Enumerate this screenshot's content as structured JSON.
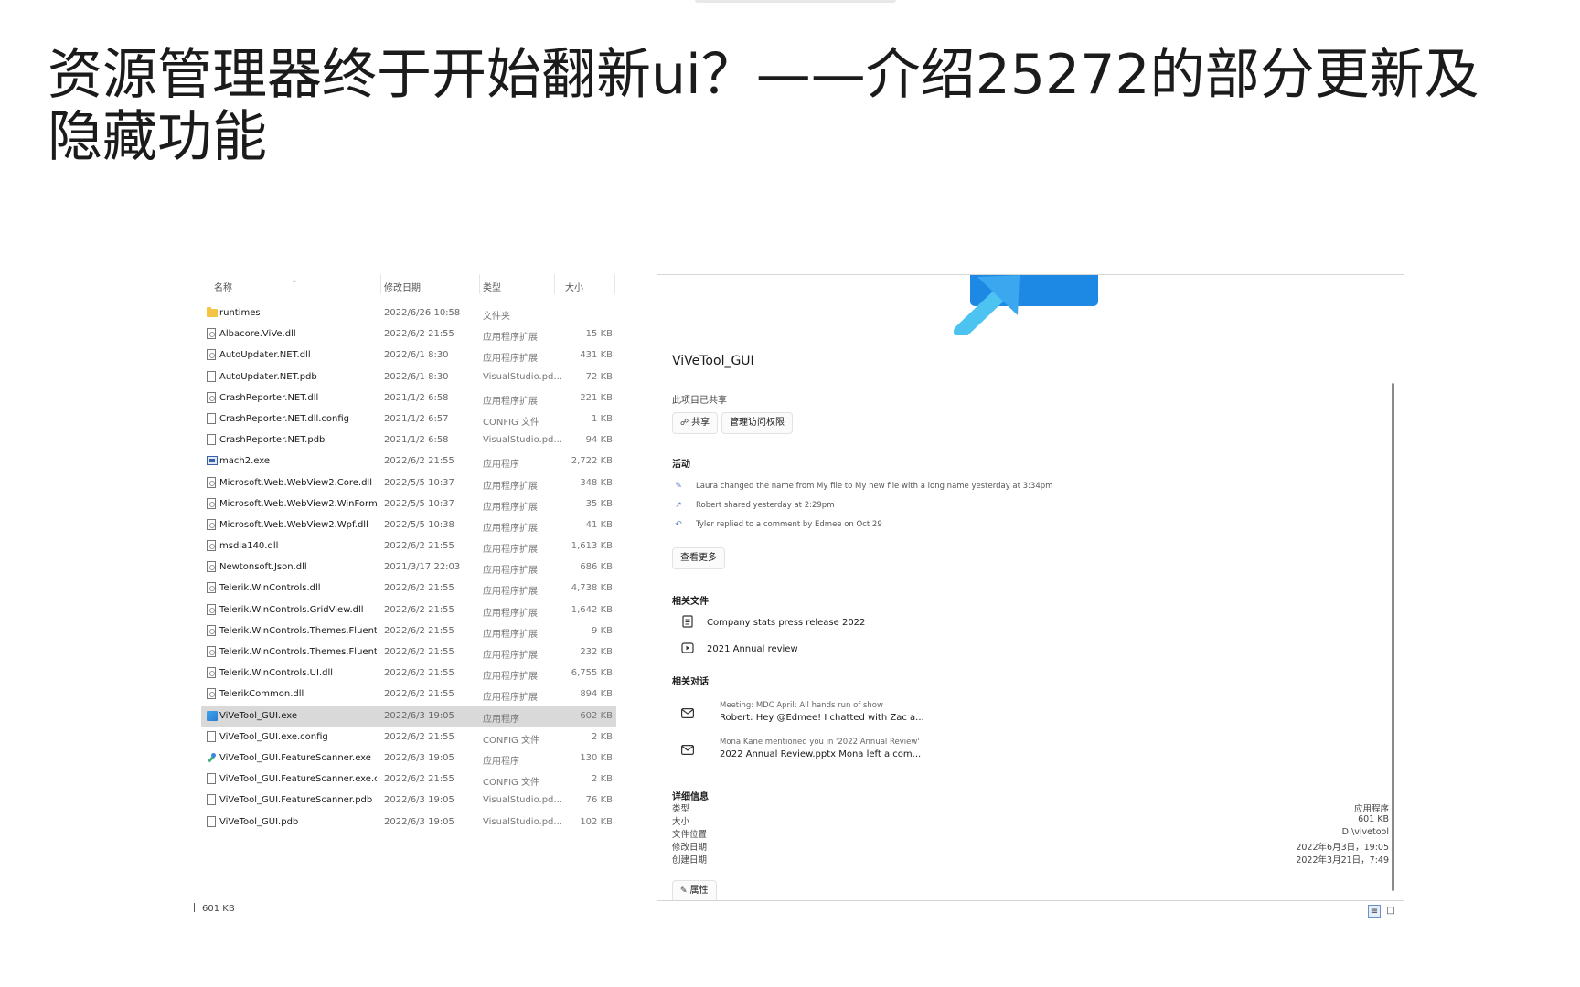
{
  "page_title": "资源管理器终于开始翻新ui？——介绍25272的部分更新及隐藏功能",
  "file_list": {
    "columns": [
      "名称",
      "修改日期",
      "类型",
      "大小"
    ],
    "rows": [
      {
        "name": "runtimes",
        "date": "2022/6/26 10:58",
        "type": "文件夹",
        "size": "",
        "icon": "folder-icon"
      },
      {
        "name": "Albacore.ViVe.dll",
        "date": "2022/6/2 21:55",
        "type": "应用程序扩展",
        "size": "15 KB",
        "icon": "dll-file-icon"
      },
      {
        "name": "AutoUpdater.NET.dll",
        "date": "2022/6/1 8:30",
        "type": "应用程序扩展",
        "size": "431 KB",
        "icon": "dll-file-icon"
      },
      {
        "name": "AutoUpdater.NET.pdb",
        "date": "2022/6/1 8:30",
        "type": "VisualStudio.pd...",
        "size": "72 KB",
        "icon": "file-icon"
      },
      {
        "name": "CrashReporter.NET.dll",
        "date": "2021/1/2 6:58",
        "type": "应用程序扩展",
        "size": "221 KB",
        "icon": "dll-file-icon"
      },
      {
        "name": "CrashReporter.NET.dll.config",
        "date": "2021/1/2 6:57",
        "type": "CONFIG 文件",
        "size": "1 KB",
        "icon": "file-icon"
      },
      {
        "name": "CrashReporter.NET.pdb",
        "date": "2021/1/2 6:58",
        "type": "VisualStudio.pd...",
        "size": "94 KB",
        "icon": "file-icon"
      },
      {
        "name": "mach2.exe",
        "date": "2022/6/2 21:55",
        "type": "应用程序",
        "size": "2,722 KB",
        "icon": "exe-icon"
      },
      {
        "name": "Microsoft.Web.WebView2.Core.dll",
        "date": "2022/5/5 10:37",
        "type": "应用程序扩展",
        "size": "348 KB",
        "icon": "dll-file-icon"
      },
      {
        "name": "Microsoft.Web.WebView2.WinForms....",
        "date": "2022/5/5 10:37",
        "type": "应用程序扩展",
        "size": "35 KB",
        "icon": "dll-file-icon"
      },
      {
        "name": "Microsoft.Web.WebView2.Wpf.dll",
        "date": "2022/5/5 10:38",
        "type": "应用程序扩展",
        "size": "41 KB",
        "icon": "dll-file-icon"
      },
      {
        "name": "msdia140.dll",
        "date": "2022/6/2 21:55",
        "type": "应用程序扩展",
        "size": "1,613 KB",
        "icon": "dll-file-icon"
      },
      {
        "name": "Newtonsoft.Json.dll",
        "date": "2021/3/17 22:03",
        "type": "应用程序扩展",
        "size": "686 KB",
        "icon": "dll-file-icon"
      },
      {
        "name": "Telerik.WinControls.dll",
        "date": "2022/6/2 21:55",
        "type": "应用程序扩展",
        "size": "4,738 KB",
        "icon": "dll-file-icon"
      },
      {
        "name": "Telerik.WinControls.GridView.dll",
        "date": "2022/6/2 21:55",
        "type": "应用程序扩展",
        "size": "1,642 KB",
        "icon": "dll-file-icon"
      },
      {
        "name": "Telerik.WinControls.Themes.Fluent.dll",
        "date": "2022/6/2 21:55",
        "type": "应用程序扩展",
        "size": "9 KB",
        "icon": "dll-file-icon"
      },
      {
        "name": "Telerik.WinControls.Themes.FluentDa...",
        "date": "2022/6/2 21:55",
        "type": "应用程序扩展",
        "size": "232 KB",
        "icon": "dll-file-icon"
      },
      {
        "name": "Telerik.WinControls.UI.dll",
        "date": "2022/6/2 21:55",
        "type": "应用程序扩展",
        "size": "6,755 KB",
        "icon": "dll-file-icon"
      },
      {
        "name": "TelerikCommon.dll",
        "date": "2022/6/2 21:55",
        "type": "应用程序扩展",
        "size": "894 KB",
        "icon": "dll-file-icon"
      },
      {
        "name": "ViVeTool_GUI.exe",
        "date": "2022/6/3 19:05",
        "type": "应用程序",
        "size": "602 KB",
        "icon": "app-icon",
        "selected": true
      },
      {
        "name": "ViVeTool_GUI.exe.config",
        "date": "2022/6/2 21:55",
        "type": "CONFIG 文件",
        "size": "2 KB",
        "icon": "file-icon"
      },
      {
        "name": "ViVeTool_GUI.FeatureScanner.exe",
        "date": "2022/6/3 19:05",
        "type": "应用程序",
        "size": "130 KB",
        "icon": "scanner-app-icon"
      },
      {
        "name": "ViVeTool_GUI.FeatureScanner.exe.co...",
        "date": "2022/6/2 21:55",
        "type": "CONFIG 文件",
        "size": "2 KB",
        "icon": "file-icon"
      },
      {
        "name": "ViVeTool_GUI.FeatureScanner.pdb",
        "date": "2022/6/3 19:05",
        "type": "VisualStudio.pd...",
        "size": "76 KB",
        "icon": "file-icon"
      },
      {
        "name": "ViVeTool_GUI.pdb",
        "date": "2022/6/3 19:05",
        "type": "VisualStudio.pd...",
        "size": "102 KB",
        "icon": "file-icon"
      }
    ]
  },
  "status_bar": {
    "selected_size": "601 KB"
  },
  "details": {
    "file_name": "ViVeTool_GUI",
    "shared_text": "此项目已共享",
    "share_button": "共享",
    "manage_access_button": "管理访问权限",
    "activity_heading": "活动",
    "activities": [
      {
        "text": "Laura changed the name from My file to My new file with a long name yesterday at 3:34pm",
        "icon": "rename-icon"
      },
      {
        "text": "Robert shared yesterday at 2:29pm",
        "icon": "share-icon"
      },
      {
        "text": "Tyler replied to a comment by Edmee on Oct 29",
        "icon": "reply-icon"
      }
    ],
    "see_more_button": "查看更多",
    "related_files_heading": "相关文件",
    "related_files": [
      {
        "name": "Company stats press release 2022",
        "icon": "document-icon"
      },
      {
        "name": "2021 Annual review",
        "icon": "video-file-icon"
      }
    ],
    "related_conversations_heading": "相关对话",
    "conversations": [
      {
        "line1": "Meeting: MDC April: All hands run of show",
        "line2": "Robert: Hey @Edmee! I chatted with Zac a...",
        "icon": "mail-icon"
      },
      {
        "line1": "Mona Kane mentioned you in '2022 Annual Review'",
        "line2": "2022 Annual Review.pptx Mona left a com...",
        "icon": "mail-icon"
      }
    ],
    "details_heading": "详细信息",
    "properties": [
      {
        "label": "类型",
        "value": "应用程序"
      },
      {
        "label": "大小",
        "value": "601 KB"
      },
      {
        "label": "文件位置",
        "value": "D:\\vivetool"
      },
      {
        "label": "修改日期",
        "value": "2022年6月3日，19:05"
      },
      {
        "label": "创建日期",
        "value": "2022年3月21日，7:49"
      }
    ],
    "properties_button": "属性"
  },
  "view_toggle": {
    "icons": [
      "details-view-icon",
      "preview-pane-icon"
    ]
  },
  "colors": {
    "accent": "#1e88e5",
    "selected_row": "#d9d9d9",
    "folder": "#f4c542"
  }
}
